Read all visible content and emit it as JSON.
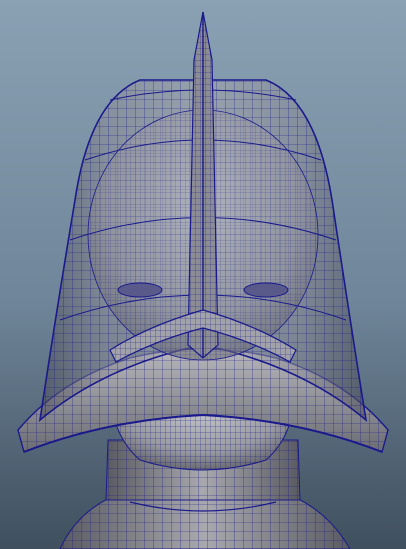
{
  "viewport": {
    "colors": {
      "background_top": "#8aa1b4",
      "background_bottom": "#3f4f5e",
      "wire": "#1a1a8c",
      "shade_light": "#b9b9bf",
      "shade_mid": "#8e8e96",
      "shade_dark": "#55555c"
    },
    "display_mode": "wireframe-on-shaded"
  }
}
